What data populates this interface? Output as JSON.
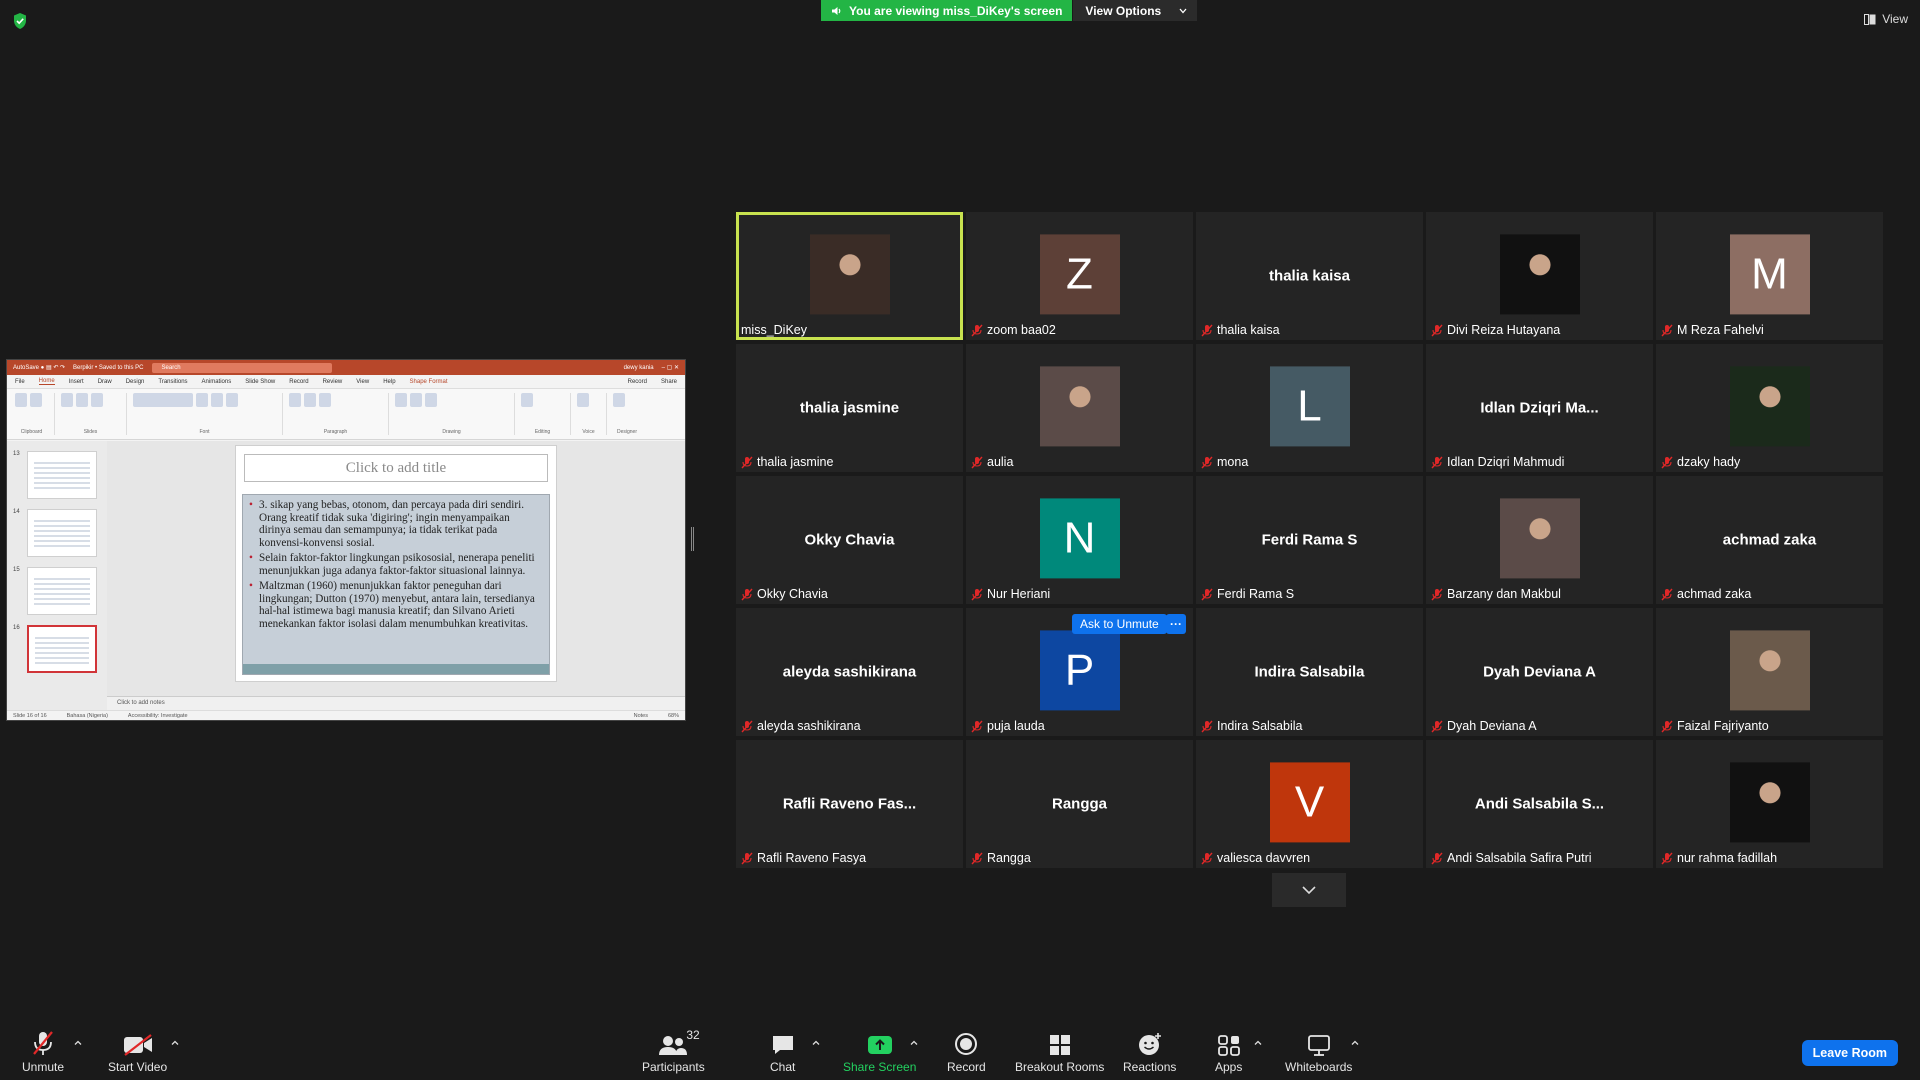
{
  "banner": {
    "viewing_text": "You are viewing miss_DiKey's screen",
    "view_options": "View Options",
    "top_right_view": "View"
  },
  "colors": {
    "banner_green": "#23b545",
    "active_speaker": "#c8e24f",
    "zoom_blue": "#0e72ed",
    "mute_red": "#e02828"
  },
  "shared_screen": {
    "app_title": "Berpikir • Saved to this PC",
    "search_placeholder": "Search",
    "user": "dewy kania",
    "tabs": [
      "File",
      "Home",
      "Insert",
      "Draw",
      "Design",
      "Transitions",
      "Animations",
      "Slide Show",
      "Record",
      "Review",
      "View",
      "Help",
      "Shape Format"
    ],
    "record_label": "Record",
    "share_label": "Share",
    "ribbon_groups": [
      "Clipboard",
      "Slides",
      "Font",
      "Paragraph",
      "Drawing",
      "Editing",
      "Voice",
      "Designer"
    ],
    "slide_numbers": [
      "13",
      "14",
      "15",
      "16"
    ],
    "slide_title_placeholder": "Click to add title",
    "slide_bullets": [
      "3. sikap yang bebas, otonom, dan percaya pada diri sendiri. Orang kreatif tidak suka 'digiring'; ingin menyampaikan dirinya semau dan semampunya; ia tidak terikat pada konvensi-konvensi sosial.",
      "Selain faktor-faktor lingkungan psikososial, nenerapa peneliti menunjukkan juga adanya faktor-faktor situasional lainnya.",
      "Maltzman (1960) menunjukkan faktor peneguhan dari lingkungan; Dutton (1970) menyebut, antara lain, tersedianya hal-hal istimewa bagi manusia kreatif; dan Silvano Arieti menekankan faktor isolasi dalam menumbuhkan kreativitas."
    ],
    "notes_placeholder": "Click to add notes",
    "status_slide": "Slide 16 of 16",
    "status_lang": "Bahasa (Nigeria)",
    "status_accessibility": "Accessibility: Investigate",
    "status_notes": "Notes",
    "zoom_level": "68%"
  },
  "participants": [
    {
      "name": "miss_DiKey",
      "label": "miss_DiKey",
      "type": "photo",
      "muted": false,
      "active": true
    },
    {
      "name": "zoom baa02",
      "label": "zoom baa02",
      "type": "letter",
      "letter": "Z",
      "bg": "#5d4037",
      "muted": true
    },
    {
      "name": "thalia kaisa",
      "label": "thalia kaisa",
      "type": "name",
      "muted": true
    },
    {
      "name": "Divi Reiza Hutayana",
      "label": "Divi Reiza Hutayana",
      "type": "photo",
      "muted": true
    },
    {
      "name": "M Reza Fahelvi",
      "label": "M Reza Fahelvi",
      "type": "letter",
      "letter": "M",
      "bg": "#8d6e63",
      "muted": true
    },
    {
      "name": "thalia jasmine",
      "label": "thalia jasmine",
      "type": "name",
      "muted": true
    },
    {
      "name": "aulia",
      "label": "aulia",
      "type": "photo",
      "muted": true
    },
    {
      "name": "mona",
      "label": "mona",
      "type": "letter",
      "letter": "L",
      "bg": "#455a64",
      "muted": true
    },
    {
      "name": "Idlan Dziqri Ma...",
      "label": "Idlan Dziqri Mahmudi",
      "type": "name",
      "muted": true
    },
    {
      "name": "dzaky hady",
      "label": "dzaky hady",
      "type": "photo",
      "muted": true
    },
    {
      "name": "Okky Chavia",
      "label": "Okky Chavia",
      "type": "name",
      "muted": true
    },
    {
      "name": "Nur Heriani",
      "label": "Nur Heriani",
      "type": "letter",
      "letter": "N",
      "bg": "#00897b",
      "muted": true
    },
    {
      "name": "Ferdi Rama S",
      "label": "Ferdi Rama S",
      "type": "name",
      "muted": true
    },
    {
      "name": "Barzany dan Makbul",
      "label": "Barzany dan Makbul",
      "type": "photo",
      "muted": true
    },
    {
      "name": "achmad zaka",
      "label": "achmad zaka",
      "type": "name",
      "muted": true
    },
    {
      "name": "aleyda sashikirana",
      "label": "aleyda sashikirana",
      "type": "name",
      "muted": true
    },
    {
      "name": "puja lauda",
      "label": "puja lauda",
      "type": "letter",
      "letter": "P",
      "bg": "#0d47a1",
      "muted": true
    },
    {
      "name": "Indira Salsabila",
      "label": "Indira Salsabila",
      "type": "name",
      "muted": true
    },
    {
      "name": "Dyah Deviana A",
      "label": "Dyah Deviana A",
      "type": "name",
      "muted": true
    },
    {
      "name": "Faizal Fajriyanto",
      "label": "Faizal Fajriyanto",
      "type": "photo",
      "muted": true
    },
    {
      "name": "Rafli Raveno Fas...",
      "label": "Rafli Raveno Fasya",
      "type": "name",
      "muted": true
    },
    {
      "name": "Rangga",
      "label": "Rangga",
      "type": "name",
      "muted": true
    },
    {
      "name": "valiesca davvren",
      "label": "valiesca davvren",
      "type": "letter",
      "letter": "V",
      "bg": "#bf360c",
      "muted": true
    },
    {
      "name": "Andi Salsabila S...",
      "label": "Andi Salsabila Safira Putri",
      "type": "name",
      "muted": true
    },
    {
      "name": "nur rahma fadillah",
      "label": "nur rahma fadillah",
      "type": "photo",
      "muted": true
    }
  ],
  "hover": {
    "ask_to_unmute": "Ask to Unmute",
    "more": "···"
  },
  "toolbar": {
    "unmute": "Unmute",
    "start_video": "Start Video",
    "participants": "Participants",
    "participants_count": "32",
    "chat": "Chat",
    "share_screen": "Share Screen",
    "record": "Record",
    "breakout_rooms": "Breakout Rooms",
    "reactions": "Reactions",
    "apps": "Apps",
    "whiteboards": "Whiteboards",
    "leave_room": "Leave Room"
  }
}
